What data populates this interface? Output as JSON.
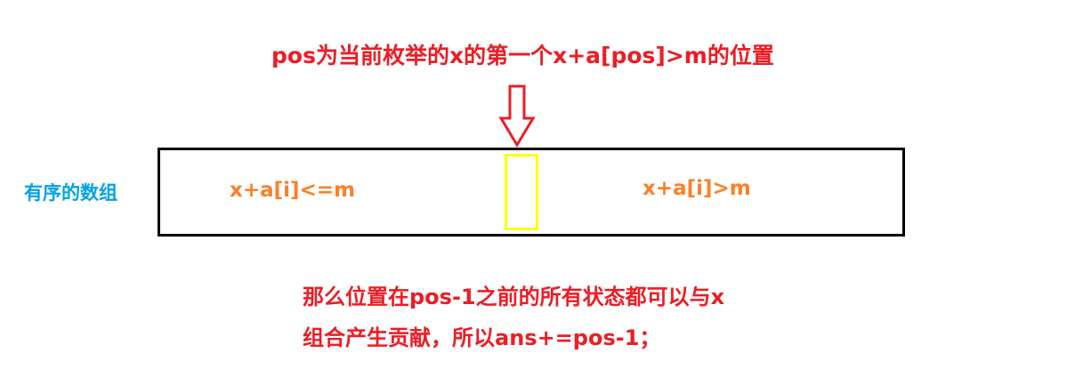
{
  "title": "pos为当前枚举的x的第一个x+a[pos]>m的位置",
  "array_label": "有序的数组",
  "left_condition": "x+a[i]<=m",
  "right_condition": "x+a[i]>m",
  "conclusion_lines": [
    "那么位置在pos-1之前的所有状态都可以与x",
    "组合产生贡献，所以ans+=pos-1；"
  ],
  "colors": {
    "title": "#ee1c24",
    "array_label": "#00a2e8",
    "conditions": "#ff7f27",
    "conclusion": "#ee1c24",
    "array_border": "#000000",
    "pos_cell_border": "#ffff00",
    "arrow": "#ee1c24"
  },
  "icons": {
    "pointer": "down-arrow-icon"
  }
}
